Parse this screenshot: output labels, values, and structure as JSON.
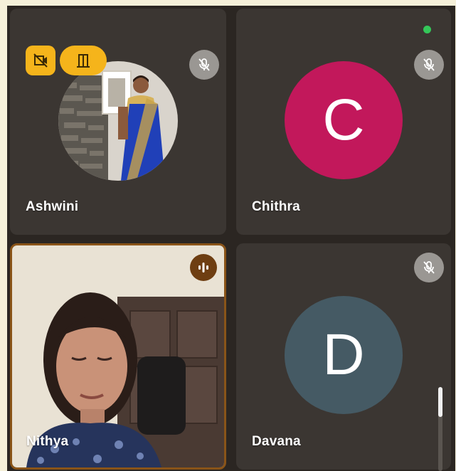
{
  "participants": [
    {
      "name": "Ashwini",
      "mic": "muted",
      "video": "off",
      "avatar_type": "photo"
    },
    {
      "name": "Chithra",
      "mic": "muted",
      "video": "off",
      "avatar_initial": "C",
      "avatar_color": "#c2185b"
    },
    {
      "name": "Nithya",
      "mic": "speaking",
      "video": "on"
    },
    {
      "name": "Davana",
      "mic": "muted",
      "video": "off",
      "avatar_initial": "D",
      "avatar_color": "#455a64"
    }
  ],
  "colors": {
    "background": "#2b2622",
    "tile": "#3b3632",
    "badge": "#f5b41b",
    "speaking_border": "#8a5418",
    "active_dot": "#34c759"
  },
  "icons": {
    "badge_1": "video-off-icon",
    "badge_2": "door-icon",
    "mic_off": "mic-off-icon",
    "speaking": "audio-wave-icon"
  }
}
